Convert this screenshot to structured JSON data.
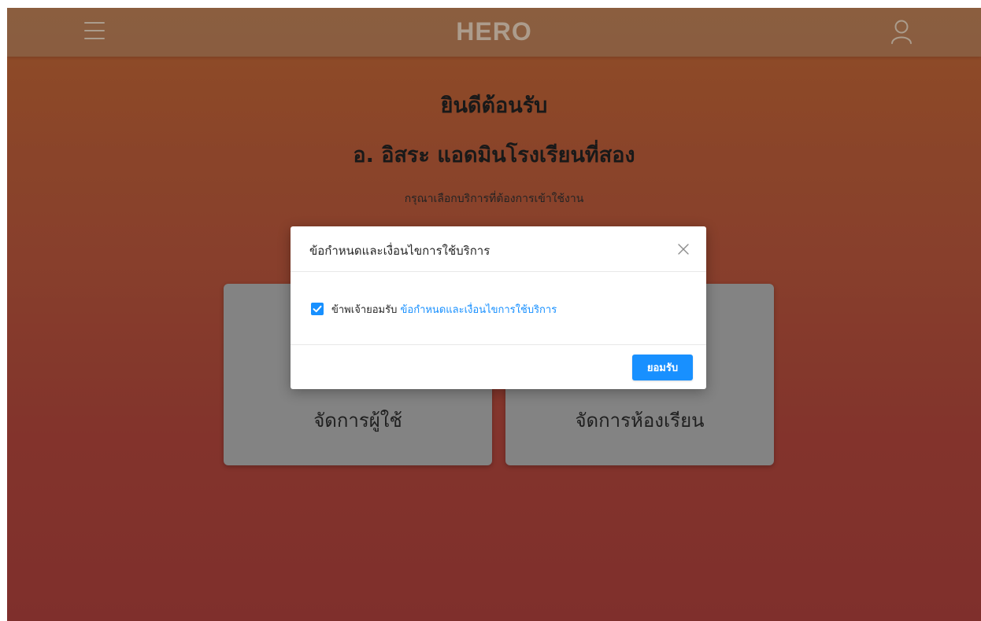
{
  "topbar": {
    "brand": "HERO",
    "menu_icon": "hamburger-menu-icon",
    "user_icon": "user-icon"
  },
  "main": {
    "welcome": "ยินดีต้อนรับ",
    "teacher_name": "อ. อิสระ แอดมินโรงเรียนที่สอง",
    "instruction": "กรุณาเลือกบริการที่ต้องการเข้าใช้งาน",
    "cards": [
      {
        "label": "จัดการผู้ใช้"
      },
      {
        "label": "จัดการห้องเรียน"
      }
    ]
  },
  "modal": {
    "title": "ข้อกำหนดและเงื่อนไขการใช้บริการ",
    "close_icon": "close-icon",
    "checkbox_checked": true,
    "agree_prefix": "ข้าพเจ้ายอมรับ",
    "agree_link": "ข้อกำหนดและเงื่อนไขการใช้บริการ",
    "accept_button": "ยอมรับ"
  },
  "colors": {
    "primary": "#1890ff",
    "gradient_top": "#a85a2e",
    "gradient_bottom": "#963834",
    "card": "#9a9a9a"
  }
}
